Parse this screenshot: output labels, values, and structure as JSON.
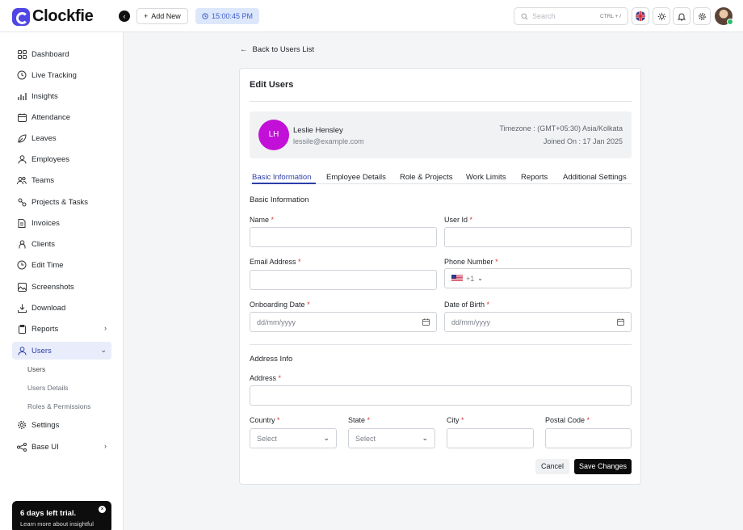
{
  "brand": {
    "name": "Clockfie",
    "accent": "#4f46e5"
  },
  "header": {
    "add_new_label": "Add New",
    "clock_time": "15:00:45 PM",
    "search_placeholder": "Search",
    "search_shortcut": "CTRL + /"
  },
  "sidebar": {
    "items": [
      {
        "label": "Dashboard",
        "icon": "dashboard-icon"
      },
      {
        "label": "Live Tracking",
        "icon": "live-tracking-icon"
      },
      {
        "label": "Insights",
        "icon": "insights-icon"
      },
      {
        "label": "Attendance",
        "icon": "calendar-icon"
      },
      {
        "label": "Leaves",
        "icon": "leaves-icon"
      },
      {
        "label": "Employees",
        "icon": "user-icon"
      },
      {
        "label": "Teams",
        "icon": "teams-icon"
      },
      {
        "label": "Projects & Tasks",
        "icon": "projects-icon"
      },
      {
        "label": "Invoices",
        "icon": "invoice-icon"
      },
      {
        "label": "Clients",
        "icon": "clients-icon"
      },
      {
        "label": "Edit Time",
        "icon": "clock-icon"
      },
      {
        "label": "Screenshots",
        "icon": "image-icon"
      },
      {
        "label": "Download",
        "icon": "download-icon"
      },
      {
        "label": "Reports",
        "icon": "reports-icon"
      },
      {
        "label": "Users",
        "icon": "users-icon"
      },
      {
        "label": "Settings",
        "icon": "gear-icon"
      },
      {
        "label": "Base UI",
        "icon": "base-ui-icon"
      }
    ],
    "users_sub": [
      "Users",
      "Users Details",
      "Roles & Permissions"
    ],
    "trial_title": "6 days left trial.",
    "trial_text": "Learn more about insightful"
  },
  "page": {
    "back_label": "Back to Users List",
    "title": "Edit Users"
  },
  "profile": {
    "initials": "LH",
    "name": "Leslie Hensley",
    "email": "lessile@example.com",
    "timezone": "Timezone : (GMT+05:30) Asia/Kolkata",
    "joined": "Joined On : 17 Jan 2025",
    "avatar_color": "#c210d8"
  },
  "tabs": [
    "Basic Information",
    "Employee Details",
    "Role & Projects",
    "Work Limits",
    "Reports",
    "Additional Settings"
  ],
  "form": {
    "basic_title": "Basic Information",
    "name_label": "Name",
    "user_id_label": "User Id",
    "email_label": "Email Address",
    "phone_label": "Phone Number",
    "phone_code": "+1",
    "onboarding_label": "Onboarding Date",
    "dob_label": "Date of Birth",
    "date_placeholder": "dd/mm/yyyy",
    "address_title": "Address Info",
    "address_label": "Address",
    "country_label": "Country",
    "state_label": "State",
    "city_label": "City",
    "postal_label": "Postal Code",
    "select_placeholder": "Select",
    "required_mark": "*"
  },
  "actions": {
    "cancel": "Cancel",
    "save": "Save Changes"
  }
}
